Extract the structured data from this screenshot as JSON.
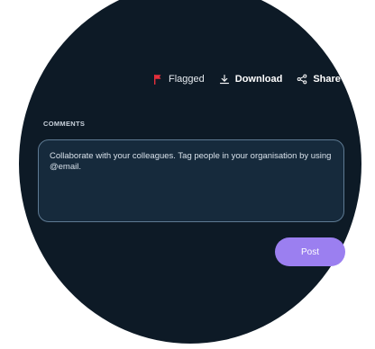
{
  "colors": {
    "background": "#0d1a26",
    "flag_accent": "#e52f3c",
    "input_background": "#162a3c",
    "input_border": "#5e7a93",
    "primary_button": "#9b7ff0"
  },
  "toolbar": {
    "flagged": {
      "icon": "flag-icon",
      "label": "Flagged"
    },
    "download": {
      "icon": "download-icon",
      "label": "Download"
    },
    "share": {
      "icon": "share-icon",
      "label": "Share"
    }
  },
  "comments": {
    "section_label": "COMMENTS",
    "placeholder": "Collaborate with your colleagues. Tag people in your organisation by using @email.",
    "value": ""
  },
  "actions": {
    "post_label": "Post"
  }
}
